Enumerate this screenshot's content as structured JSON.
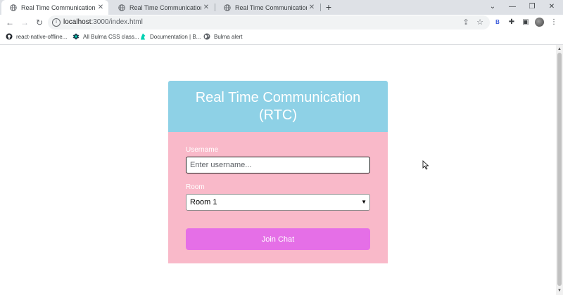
{
  "browser": {
    "tabs": [
      {
        "title": "Real Time Communication",
        "active": true
      },
      {
        "title": "Real Time Communication",
        "active": false
      },
      {
        "title": "Real Time Communication",
        "active": false
      }
    ],
    "new_tab": "+",
    "window_controls": {
      "chevron": "⌄",
      "minimize": "—",
      "restore": "❐",
      "close": "✕"
    },
    "url_host": "localhost",
    "url_path": ":3000/index.html",
    "extension_badge": "B",
    "bookmarks": [
      {
        "label": "react-native-offline...",
        "icon": "github-icon"
      },
      {
        "label": "All Bulma CSS class...",
        "icon": "bulma-icon"
      },
      {
        "label": "Documentation | B...",
        "icon": "bulma-docs-icon"
      },
      {
        "label": "Bulma alert",
        "icon": "globe-icon"
      }
    ]
  },
  "page": {
    "title": "Real Time Communication (RTC)",
    "username_label": "Username",
    "username_placeholder": "Enter username...",
    "room_label": "Room",
    "room_selected": "Room 1",
    "join_button": "Join Chat"
  },
  "colors": {
    "header_bg": "#8ed1e6",
    "body_bg": "#f9b9c9",
    "button_bg": "#e56fe7"
  }
}
